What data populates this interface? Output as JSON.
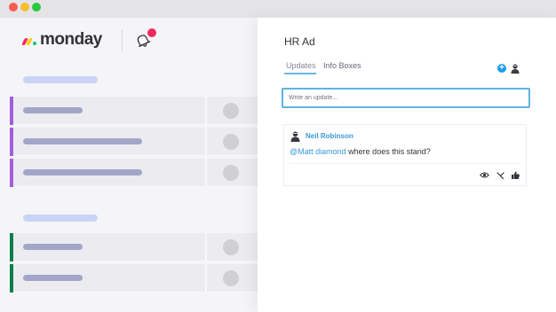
{
  "window": {
    "controls": [
      "close",
      "minimize",
      "zoom"
    ]
  },
  "brand": {
    "name": "monday",
    "icon": "monday-logo-icon"
  },
  "header": {
    "notification_icon": "bell-icon",
    "notification_badge_color": "#f2295b"
  },
  "board": {
    "groups": [
      {
        "rows": [
          {
            "color": "#a25ddc"
          },
          {
            "color": "#a25ddc"
          },
          {
            "color": "#a25ddc"
          }
        ]
      },
      {
        "rows": [
          {
            "color": "#037f4c"
          },
          {
            "color": "#037f4c"
          }
        ]
      }
    ]
  },
  "panel": {
    "title": "HR Ad",
    "tabs": [
      {
        "label": "Updates",
        "active": true
      },
      {
        "label": "Info Boxes",
        "active": false
      }
    ],
    "add_icon": "plus-circle-icon",
    "input_placeholder": "Write an update...",
    "update": {
      "author": "Neil Robinson",
      "mention": "@Matt diamond",
      "text": " where does this stand?",
      "actions": [
        "eye-icon",
        "reply-icon",
        "thumbs-up-icon"
      ]
    },
    "accent_color": "#3a98d8"
  }
}
